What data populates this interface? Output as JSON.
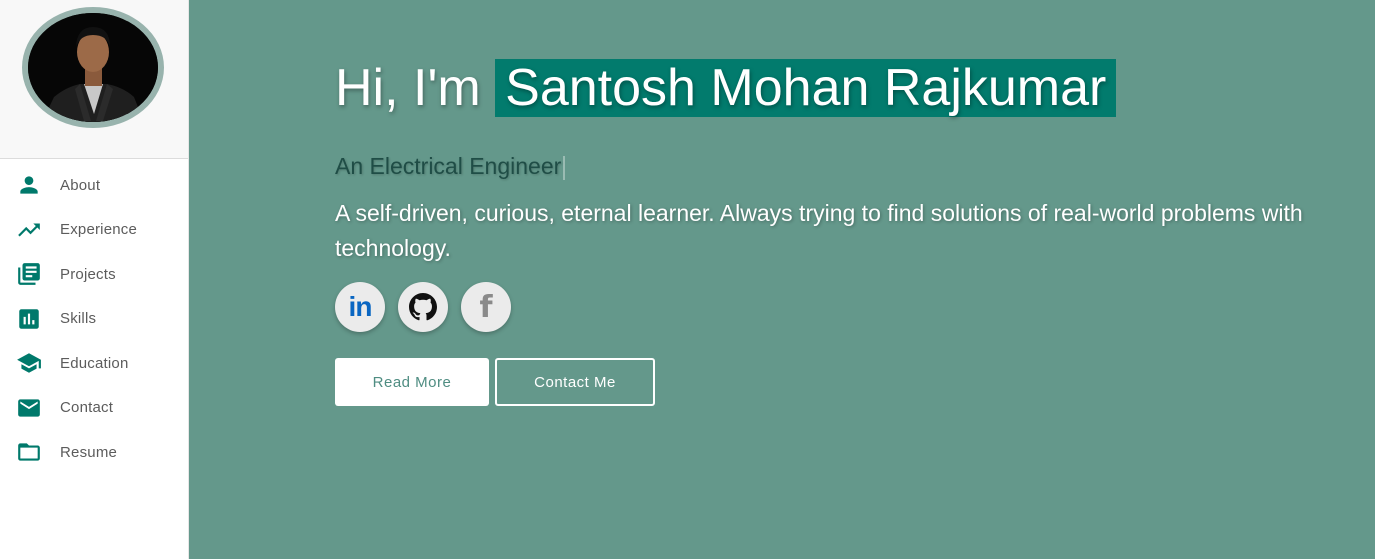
{
  "sidebar": {
    "items": [
      {
        "label": "About",
        "icon": "person-icon"
      },
      {
        "label": "Experience",
        "icon": "trending-up-icon"
      },
      {
        "label": "Projects",
        "icon": "library-books-icon"
      },
      {
        "label": "Skills",
        "icon": "bar-chart-icon"
      },
      {
        "label": "Education",
        "icon": "graduation-cap-icon"
      },
      {
        "label": "Contact",
        "icon": "mail-icon"
      },
      {
        "label": "Resume",
        "icon": "folder-icon"
      }
    ]
  },
  "hero": {
    "greeting": "Hi, I'm",
    "name": "Santosh Mohan Rajkumar",
    "subtitle": "An Electrical Engineer",
    "description": "A self-driven, curious, eternal learner. Always trying to find solutions of real-world problems with technology."
  },
  "socials": {
    "linkedin_text": "in",
    "facebook_text": "f"
  },
  "buttons": {
    "read_more": "Read More",
    "contact_me": "Contact Me"
  },
  "colors": {
    "accent": "#00796b",
    "main_background": "#64988b",
    "name_highlight": "#027b6d"
  }
}
